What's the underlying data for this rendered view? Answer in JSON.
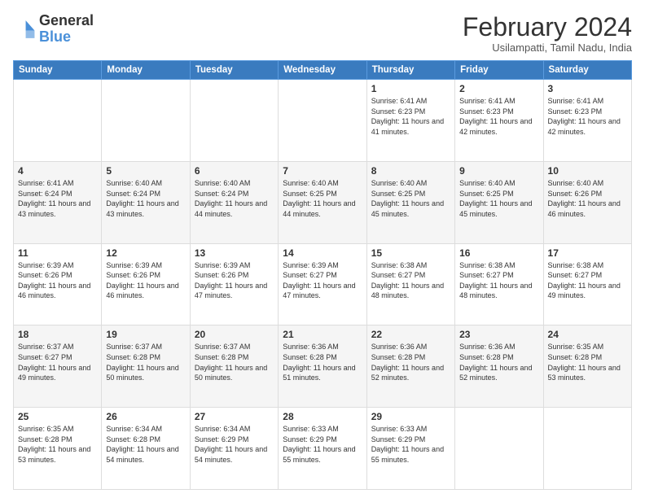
{
  "logo": {
    "line1": "General",
    "line2": "Blue"
  },
  "header": {
    "title": "February 2024",
    "subtitle": "Usilampatti, Tamil Nadu, India"
  },
  "days_of_week": [
    "Sunday",
    "Monday",
    "Tuesday",
    "Wednesday",
    "Thursday",
    "Friday",
    "Saturday"
  ],
  "weeks": [
    [
      {
        "day": "",
        "info": ""
      },
      {
        "day": "",
        "info": ""
      },
      {
        "day": "",
        "info": ""
      },
      {
        "day": "",
        "info": ""
      },
      {
        "day": "1",
        "info": "Sunrise: 6:41 AM\nSunset: 6:23 PM\nDaylight: 11 hours\nand 41 minutes."
      },
      {
        "day": "2",
        "info": "Sunrise: 6:41 AM\nSunset: 6:23 PM\nDaylight: 11 hours\nand 42 minutes."
      },
      {
        "day": "3",
        "info": "Sunrise: 6:41 AM\nSunset: 6:23 PM\nDaylight: 11 hours\nand 42 minutes."
      }
    ],
    [
      {
        "day": "4",
        "info": "Sunrise: 6:41 AM\nSunset: 6:24 PM\nDaylight: 11 hours\nand 43 minutes."
      },
      {
        "day": "5",
        "info": "Sunrise: 6:40 AM\nSunset: 6:24 PM\nDaylight: 11 hours\nand 43 minutes."
      },
      {
        "day": "6",
        "info": "Sunrise: 6:40 AM\nSunset: 6:24 PM\nDaylight: 11 hours\nand 44 minutes."
      },
      {
        "day": "7",
        "info": "Sunrise: 6:40 AM\nSunset: 6:25 PM\nDaylight: 11 hours\nand 44 minutes."
      },
      {
        "day": "8",
        "info": "Sunrise: 6:40 AM\nSunset: 6:25 PM\nDaylight: 11 hours\nand 45 minutes."
      },
      {
        "day": "9",
        "info": "Sunrise: 6:40 AM\nSunset: 6:25 PM\nDaylight: 11 hours\nand 45 minutes."
      },
      {
        "day": "10",
        "info": "Sunrise: 6:40 AM\nSunset: 6:26 PM\nDaylight: 11 hours\nand 46 minutes."
      }
    ],
    [
      {
        "day": "11",
        "info": "Sunrise: 6:39 AM\nSunset: 6:26 PM\nDaylight: 11 hours\nand 46 minutes."
      },
      {
        "day": "12",
        "info": "Sunrise: 6:39 AM\nSunset: 6:26 PM\nDaylight: 11 hours\nand 46 minutes."
      },
      {
        "day": "13",
        "info": "Sunrise: 6:39 AM\nSunset: 6:26 PM\nDaylight: 11 hours\nand 47 minutes."
      },
      {
        "day": "14",
        "info": "Sunrise: 6:39 AM\nSunset: 6:27 PM\nDaylight: 11 hours\nand 47 minutes."
      },
      {
        "day": "15",
        "info": "Sunrise: 6:38 AM\nSunset: 6:27 PM\nDaylight: 11 hours\nand 48 minutes."
      },
      {
        "day": "16",
        "info": "Sunrise: 6:38 AM\nSunset: 6:27 PM\nDaylight: 11 hours\nand 48 minutes."
      },
      {
        "day": "17",
        "info": "Sunrise: 6:38 AM\nSunset: 6:27 PM\nDaylight: 11 hours\nand 49 minutes."
      }
    ],
    [
      {
        "day": "18",
        "info": "Sunrise: 6:37 AM\nSunset: 6:27 PM\nDaylight: 11 hours\nand 49 minutes."
      },
      {
        "day": "19",
        "info": "Sunrise: 6:37 AM\nSunset: 6:28 PM\nDaylight: 11 hours\nand 50 minutes."
      },
      {
        "day": "20",
        "info": "Sunrise: 6:37 AM\nSunset: 6:28 PM\nDaylight: 11 hours\nand 50 minutes."
      },
      {
        "day": "21",
        "info": "Sunrise: 6:36 AM\nSunset: 6:28 PM\nDaylight: 11 hours\nand 51 minutes."
      },
      {
        "day": "22",
        "info": "Sunrise: 6:36 AM\nSunset: 6:28 PM\nDaylight: 11 hours\nand 52 minutes."
      },
      {
        "day": "23",
        "info": "Sunrise: 6:36 AM\nSunset: 6:28 PM\nDaylight: 11 hours\nand 52 minutes."
      },
      {
        "day": "24",
        "info": "Sunrise: 6:35 AM\nSunset: 6:28 PM\nDaylight: 11 hours\nand 53 minutes."
      }
    ],
    [
      {
        "day": "25",
        "info": "Sunrise: 6:35 AM\nSunset: 6:28 PM\nDaylight: 11 hours\nand 53 minutes."
      },
      {
        "day": "26",
        "info": "Sunrise: 6:34 AM\nSunset: 6:28 PM\nDaylight: 11 hours\nand 54 minutes."
      },
      {
        "day": "27",
        "info": "Sunrise: 6:34 AM\nSunset: 6:29 PM\nDaylight: 11 hours\nand 54 minutes."
      },
      {
        "day": "28",
        "info": "Sunrise: 6:33 AM\nSunset: 6:29 PM\nDaylight: 11 hours\nand 55 minutes."
      },
      {
        "day": "29",
        "info": "Sunrise: 6:33 AM\nSunset: 6:29 PM\nDaylight: 11 hours\nand 55 minutes."
      },
      {
        "day": "",
        "info": ""
      },
      {
        "day": "",
        "info": ""
      }
    ]
  ]
}
